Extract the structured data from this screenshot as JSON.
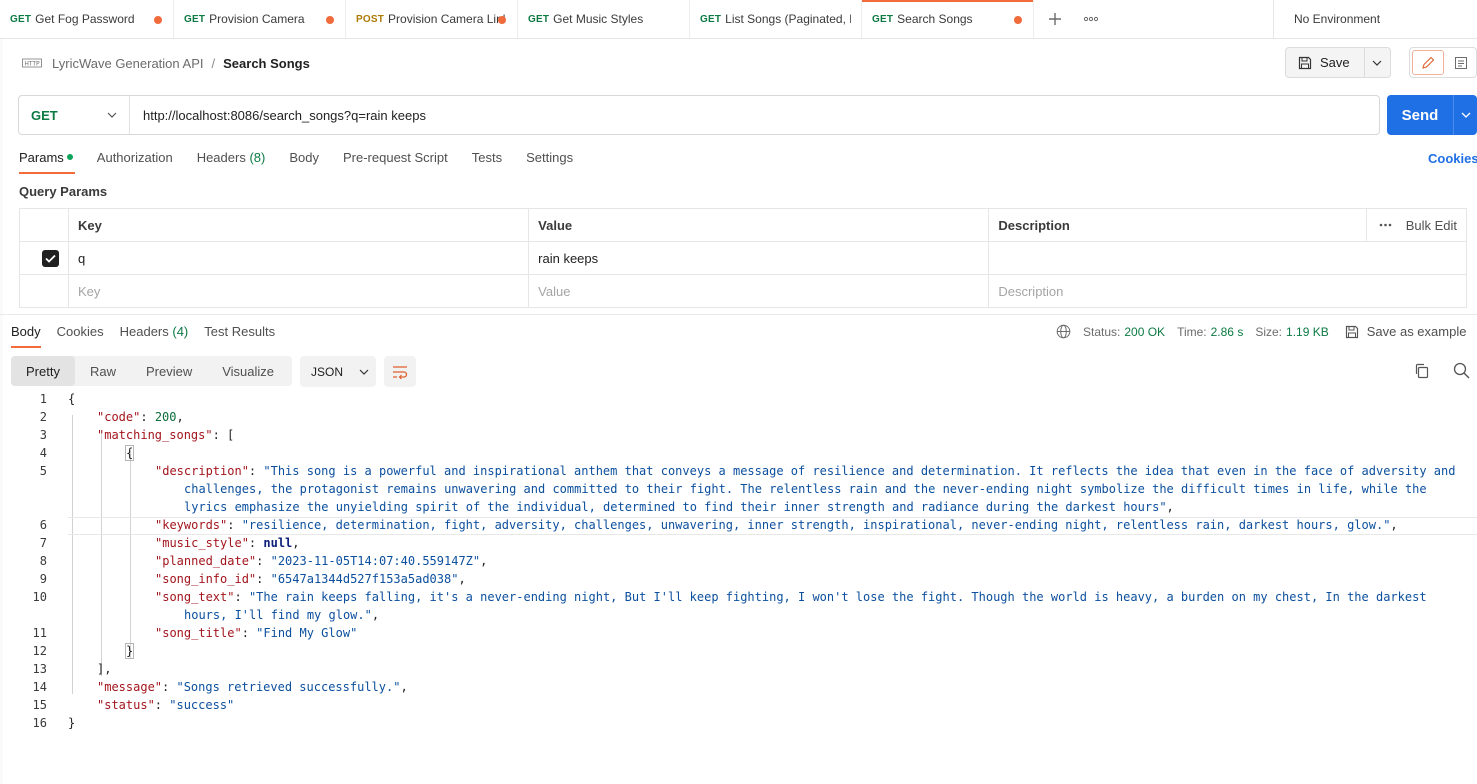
{
  "tabs": [
    {
      "method": "GET",
      "name": "Get Fog Password",
      "unsaved": true
    },
    {
      "method": "GET",
      "name": "Provision Camera",
      "unsaved": true
    },
    {
      "method": "POST",
      "name": "Provision Camera Linl",
      "unsaved": true
    },
    {
      "method": "GET",
      "name": "Get Music Styles",
      "unsaved": false
    },
    {
      "method": "GET",
      "name": "List Songs (Paginated, Da",
      "unsaved": false
    },
    {
      "method": "GET",
      "name": "Search Songs",
      "unsaved": true
    }
  ],
  "environment": "No Environment",
  "breadcrumb": {
    "collection": "LyricWave Generation API",
    "separator": "/",
    "request": "Search Songs"
  },
  "toolbar": {
    "save_label": "Save"
  },
  "request": {
    "method": "GET",
    "url": "http://localhost:8086/search_songs?q=rain keeps",
    "send_label": "Send"
  },
  "request_tabs": [
    {
      "label": "Params",
      "count": "",
      "active": true
    },
    {
      "label": "Authorization",
      "count": ""
    },
    {
      "label": "Headers",
      "count": "(8)"
    },
    {
      "label": "Body",
      "count": ""
    },
    {
      "label": "Pre-request Script",
      "count": ""
    },
    {
      "label": "Tests",
      "count": ""
    },
    {
      "label": "Settings",
      "count": ""
    }
  ],
  "cookies_label": "Cookies",
  "query_params": {
    "title": "Query Params",
    "headers": {
      "key": "Key",
      "value": "Value",
      "description": "Description",
      "bulk_edit": "Bulk Edit"
    },
    "rows": [
      {
        "key": "q",
        "value": "rain keeps",
        "description": "",
        "checked": true
      }
    ],
    "placeholders": {
      "key": "Key",
      "value": "Value",
      "description": "Description"
    }
  },
  "response_tabs": [
    {
      "label": "Body",
      "count": "",
      "active": true
    },
    {
      "label": "Cookies",
      "count": ""
    },
    {
      "label": "Headers",
      "count": "(4)"
    },
    {
      "label": "Test Results",
      "count": ""
    }
  ],
  "response_status": {
    "status_label": "Status:",
    "status_value": "200 OK",
    "time_label": "Time:",
    "time_value": "2.86 s",
    "size_label": "Size:",
    "size_value": "1.19 KB",
    "save_example": "Save as example"
  },
  "view_modes": [
    "Pretty",
    "Raw",
    "Preview",
    "Visualize"
  ],
  "format": "JSON",
  "colors": {
    "accent": "#f26b3a",
    "send": "#1f6fe5",
    "get": "#0c7a43",
    "post": "#ad7a03"
  },
  "code_lines": [
    {
      "n": "1",
      "indent": 0,
      "parts": [
        {
          "t": "p",
          "v": "{"
        }
      ]
    },
    {
      "n": "2",
      "indent": 1,
      "parts": [
        {
          "t": "k",
          "v": "\"code\""
        },
        {
          "t": "p",
          "v": ": "
        },
        {
          "t": "n",
          "v": "200"
        },
        {
          "t": "p",
          "v": ","
        }
      ]
    },
    {
      "n": "3",
      "indent": 1,
      "parts": [
        {
          "t": "k",
          "v": "\"matching_songs\""
        },
        {
          "t": "p",
          "v": ": ["
        }
      ]
    },
    {
      "n": "4",
      "indent": 2,
      "parts": [
        {
          "t": "b",
          "v": "{"
        }
      ]
    },
    {
      "n": "5",
      "indent": 3,
      "parts": [
        {
          "t": "k",
          "v": "\"description\""
        },
        {
          "t": "p",
          "v": ": "
        },
        {
          "t": "s",
          "v": "\"This song is a powerful and inspirational anthem that conveys a message of resilience and determination. It reflects the idea that even in the face of adversity and"
        }
      ]
    },
    {
      "n": "",
      "indent": 4,
      "parts": [
        {
          "t": "s",
          "v": "challenges, the protagonist remains unwavering and committed to their fight. The relentless rain and the never-ending night symbolize the difficult times in life, while the"
        }
      ]
    },
    {
      "n": "",
      "indent": 4,
      "parts": [
        {
          "t": "s",
          "v": "lyrics emphasize the unyielding spirit of the individual, determined to find their inner strength and radiance during the darkest hours\""
        },
        {
          "t": "p",
          "v": ","
        }
      ]
    },
    {
      "n": "6",
      "indent": 3,
      "hl": true,
      "parts": [
        {
          "t": "k",
          "v": "\"keywords\""
        },
        {
          "t": "p",
          "v": ": "
        },
        {
          "t": "s",
          "v": "\"resilience, determination, fight, adversity, challenges, unwavering, inner strength, inspirational, never-ending night, relentless rain, darkest hours, glow.\""
        },
        {
          "t": "p",
          "v": ","
        }
      ]
    },
    {
      "n": "7",
      "indent": 3,
      "parts": [
        {
          "t": "k",
          "v": "\"music_style\""
        },
        {
          "t": "p",
          "v": ": "
        },
        {
          "t": "nl",
          "v": "null"
        },
        {
          "t": "p",
          "v": ","
        }
      ]
    },
    {
      "n": "8",
      "indent": 3,
      "parts": [
        {
          "t": "k",
          "v": "\"planned_date\""
        },
        {
          "t": "p",
          "v": ": "
        },
        {
          "t": "s",
          "v": "\"2023-11-05T14:07:40.559147Z\""
        },
        {
          "t": "p",
          "v": ","
        }
      ]
    },
    {
      "n": "9",
      "indent": 3,
      "parts": [
        {
          "t": "k",
          "v": "\"song_info_id\""
        },
        {
          "t": "p",
          "v": ": "
        },
        {
          "t": "s",
          "v": "\"6547a1344d527f153a5ad038\""
        },
        {
          "t": "p",
          "v": ","
        }
      ]
    },
    {
      "n": "10",
      "indent": 3,
      "parts": [
        {
          "t": "k",
          "v": "\"song_text\""
        },
        {
          "t": "p",
          "v": ": "
        },
        {
          "t": "s",
          "v": "\"The rain keeps falling, it's a never-ending night, But I'll keep fighting, I won't lose the fight. Though the world is heavy, a burden on my chest, In the darkest"
        }
      ]
    },
    {
      "n": "",
      "indent": 4,
      "parts": [
        {
          "t": "s",
          "v": "hours, I'll find my glow.\""
        },
        {
          "t": "p",
          "v": ","
        }
      ]
    },
    {
      "n": "11",
      "indent": 3,
      "parts": [
        {
          "t": "k",
          "v": "\"song_title\""
        },
        {
          "t": "p",
          "v": ": "
        },
        {
          "t": "s",
          "v": "\"Find My Glow\""
        }
      ]
    },
    {
      "n": "12",
      "indent": 2,
      "parts": [
        {
          "t": "b",
          "v": "}"
        }
      ]
    },
    {
      "n": "13",
      "indent": 1,
      "parts": [
        {
          "t": "p",
          "v": "],"
        }
      ]
    },
    {
      "n": "14",
      "indent": 1,
      "parts": [
        {
          "t": "k",
          "v": "\"message\""
        },
        {
          "t": "p",
          "v": ": "
        },
        {
          "t": "s",
          "v": "\"Songs retrieved successfully.\""
        },
        {
          "t": "p",
          "v": ","
        }
      ]
    },
    {
      "n": "15",
      "indent": 1,
      "parts": [
        {
          "t": "k",
          "v": "\"status\""
        },
        {
          "t": "p",
          "v": ": "
        },
        {
          "t": "s",
          "v": "\"success\""
        }
      ]
    },
    {
      "n": "16",
      "indent": 0,
      "parts": [
        {
          "t": "p",
          "v": "}"
        }
      ]
    }
  ]
}
